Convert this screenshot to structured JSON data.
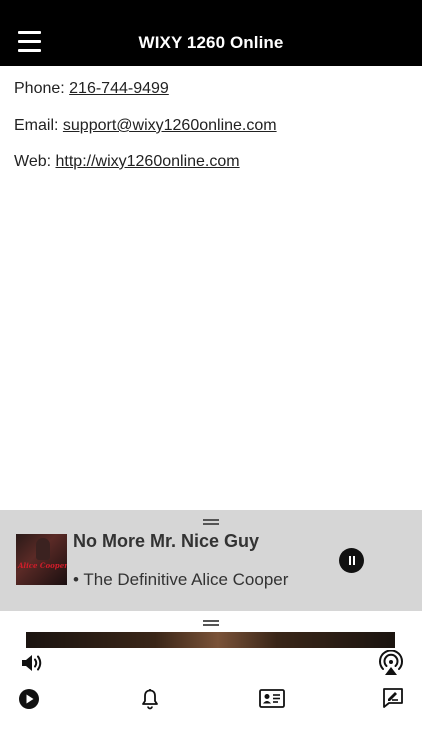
{
  "header": {
    "title": "WIXY 1260 Online",
    "menu_icon": "hamburger-menu-icon"
  },
  "contact": {
    "phone_label": "Phone: ",
    "phone": "216-744-9499",
    "email_label": "Email: ",
    "email": "support@wixy1260online.com",
    "web_label": "Web: ",
    "web": "http://wixy1260online.com"
  },
  "now_playing": {
    "song": "No More Mr. Nice Guy",
    "album": "• The Definitive Alice Cooper",
    "album_art_text": "Alice Cooper",
    "state_icon": "pause-icon"
  },
  "controls": {
    "volume_icon": "volume-icon",
    "airplay_icon": "airplay-icon"
  },
  "tabbar": {
    "items": [
      {
        "icon": "play-circle-icon"
      },
      {
        "icon": "bell-icon"
      },
      {
        "icon": "contact-card-icon"
      },
      {
        "icon": "feedback-icon"
      }
    ]
  }
}
